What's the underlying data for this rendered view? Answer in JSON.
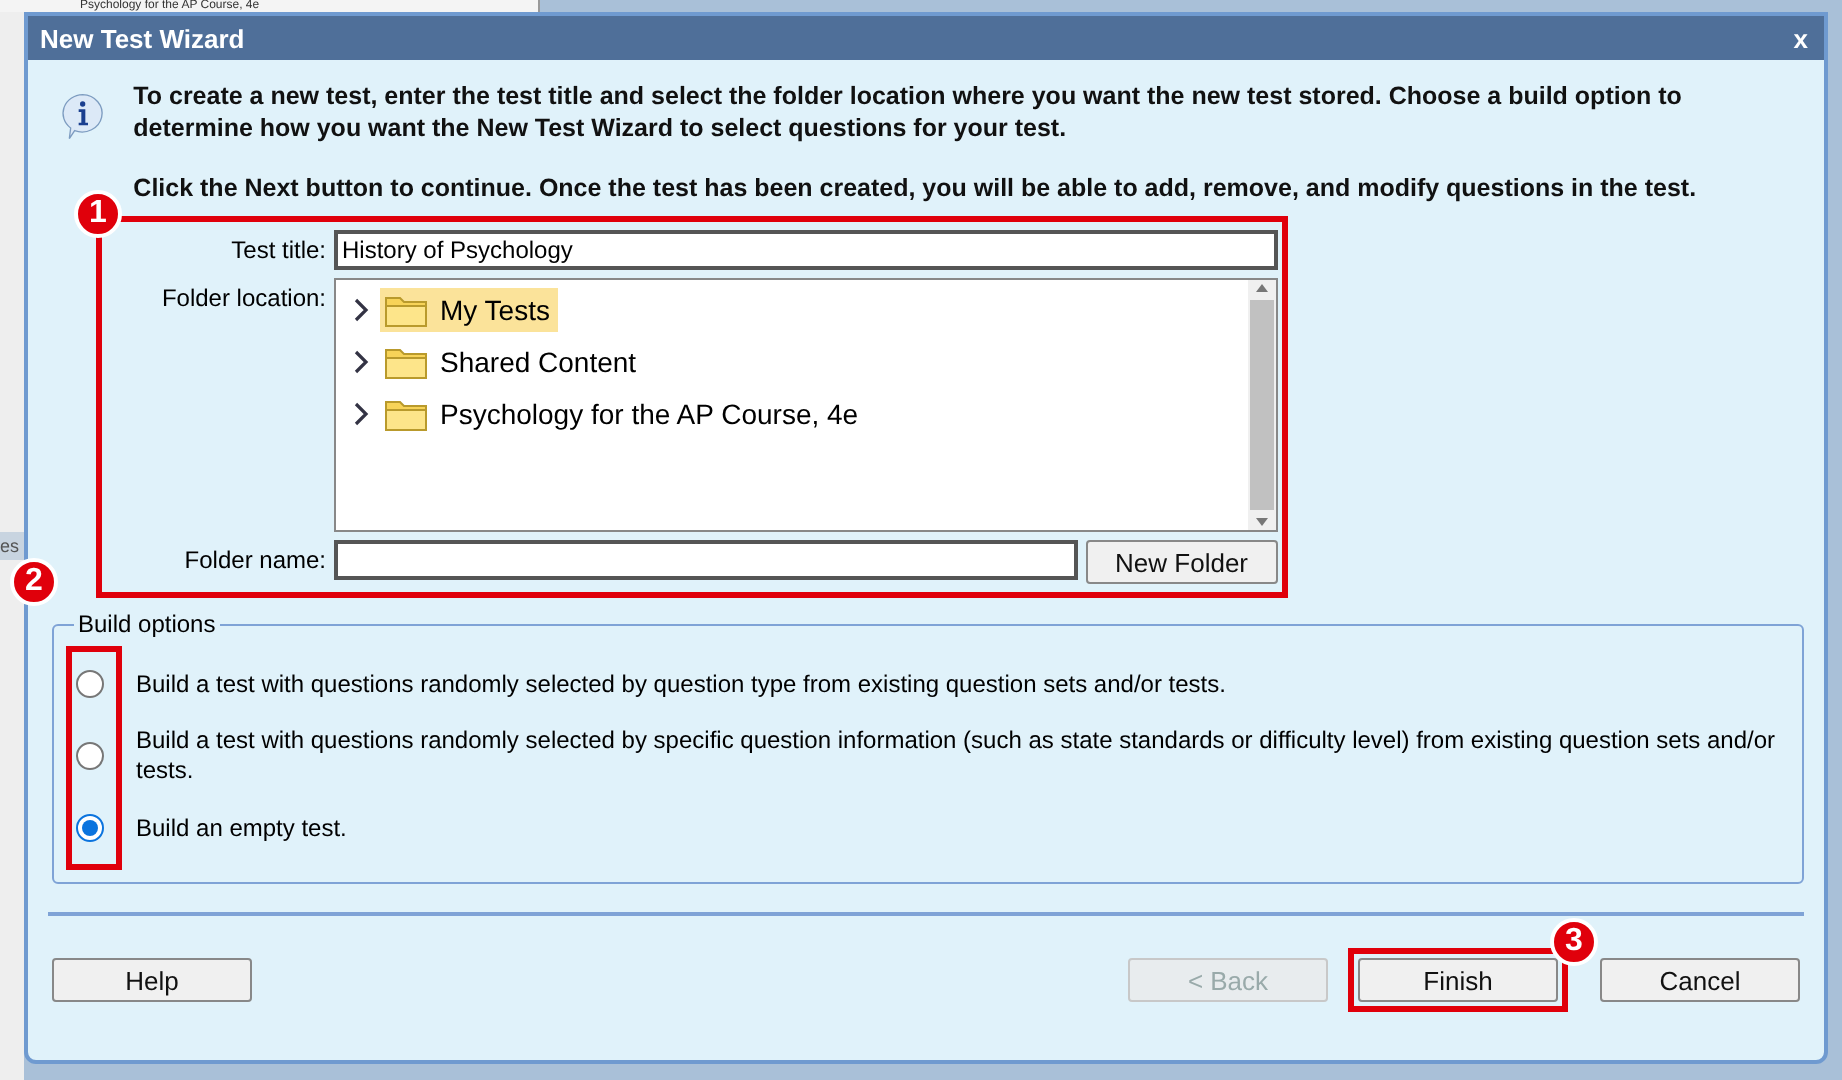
{
  "background": {
    "header_text": "Psychology for the AP Course, 4e",
    "side_tab": "es"
  },
  "window": {
    "title": "New Test Wizard",
    "close": "x"
  },
  "intro": [
    "To create a new test, enter the test title and select the folder location where you want the new test stored. Choose a build option to determine how you want the New Test Wizard to select questions for your test.",
    "Click the Next button to continue. Once the test has been created, you will be able to add, remove, and modify questions in the test."
  ],
  "form": {
    "test_title_label": "Test title:",
    "test_title": "History of Psychology",
    "folder_location_label": "Folder location:",
    "folder_name_label": "Folder name:",
    "new_folder_button": "New Folder"
  },
  "folders": [
    {
      "name": "My Tests",
      "selected": true
    },
    {
      "name": "Shared Content",
      "selected": false
    },
    {
      "name": "Psychology for the AP Course, 4e",
      "selected": false
    }
  ],
  "build_options": {
    "legend": "Build options",
    "options": [
      {
        "label": "Build a test with questions randomly selected by question type from existing question sets and/or tests.",
        "selected": false
      },
      {
        "label": "Build a test with questions randomly selected by specific question information (such as state standards or difficulty level) from existing question sets and/or tests.",
        "selected": false
      },
      {
        "label": "Build an empty test.",
        "selected": true
      }
    ]
  },
  "annotations": [
    "1",
    "2",
    "3"
  ],
  "buttons": [
    {
      "label": "Help",
      "disabled": false
    },
    {
      "label": "< Back",
      "disabled": true
    },
    {
      "label": "Finish",
      "disabled": false
    },
    {
      "label": "Cancel",
      "disabled": false
    }
  ]
}
